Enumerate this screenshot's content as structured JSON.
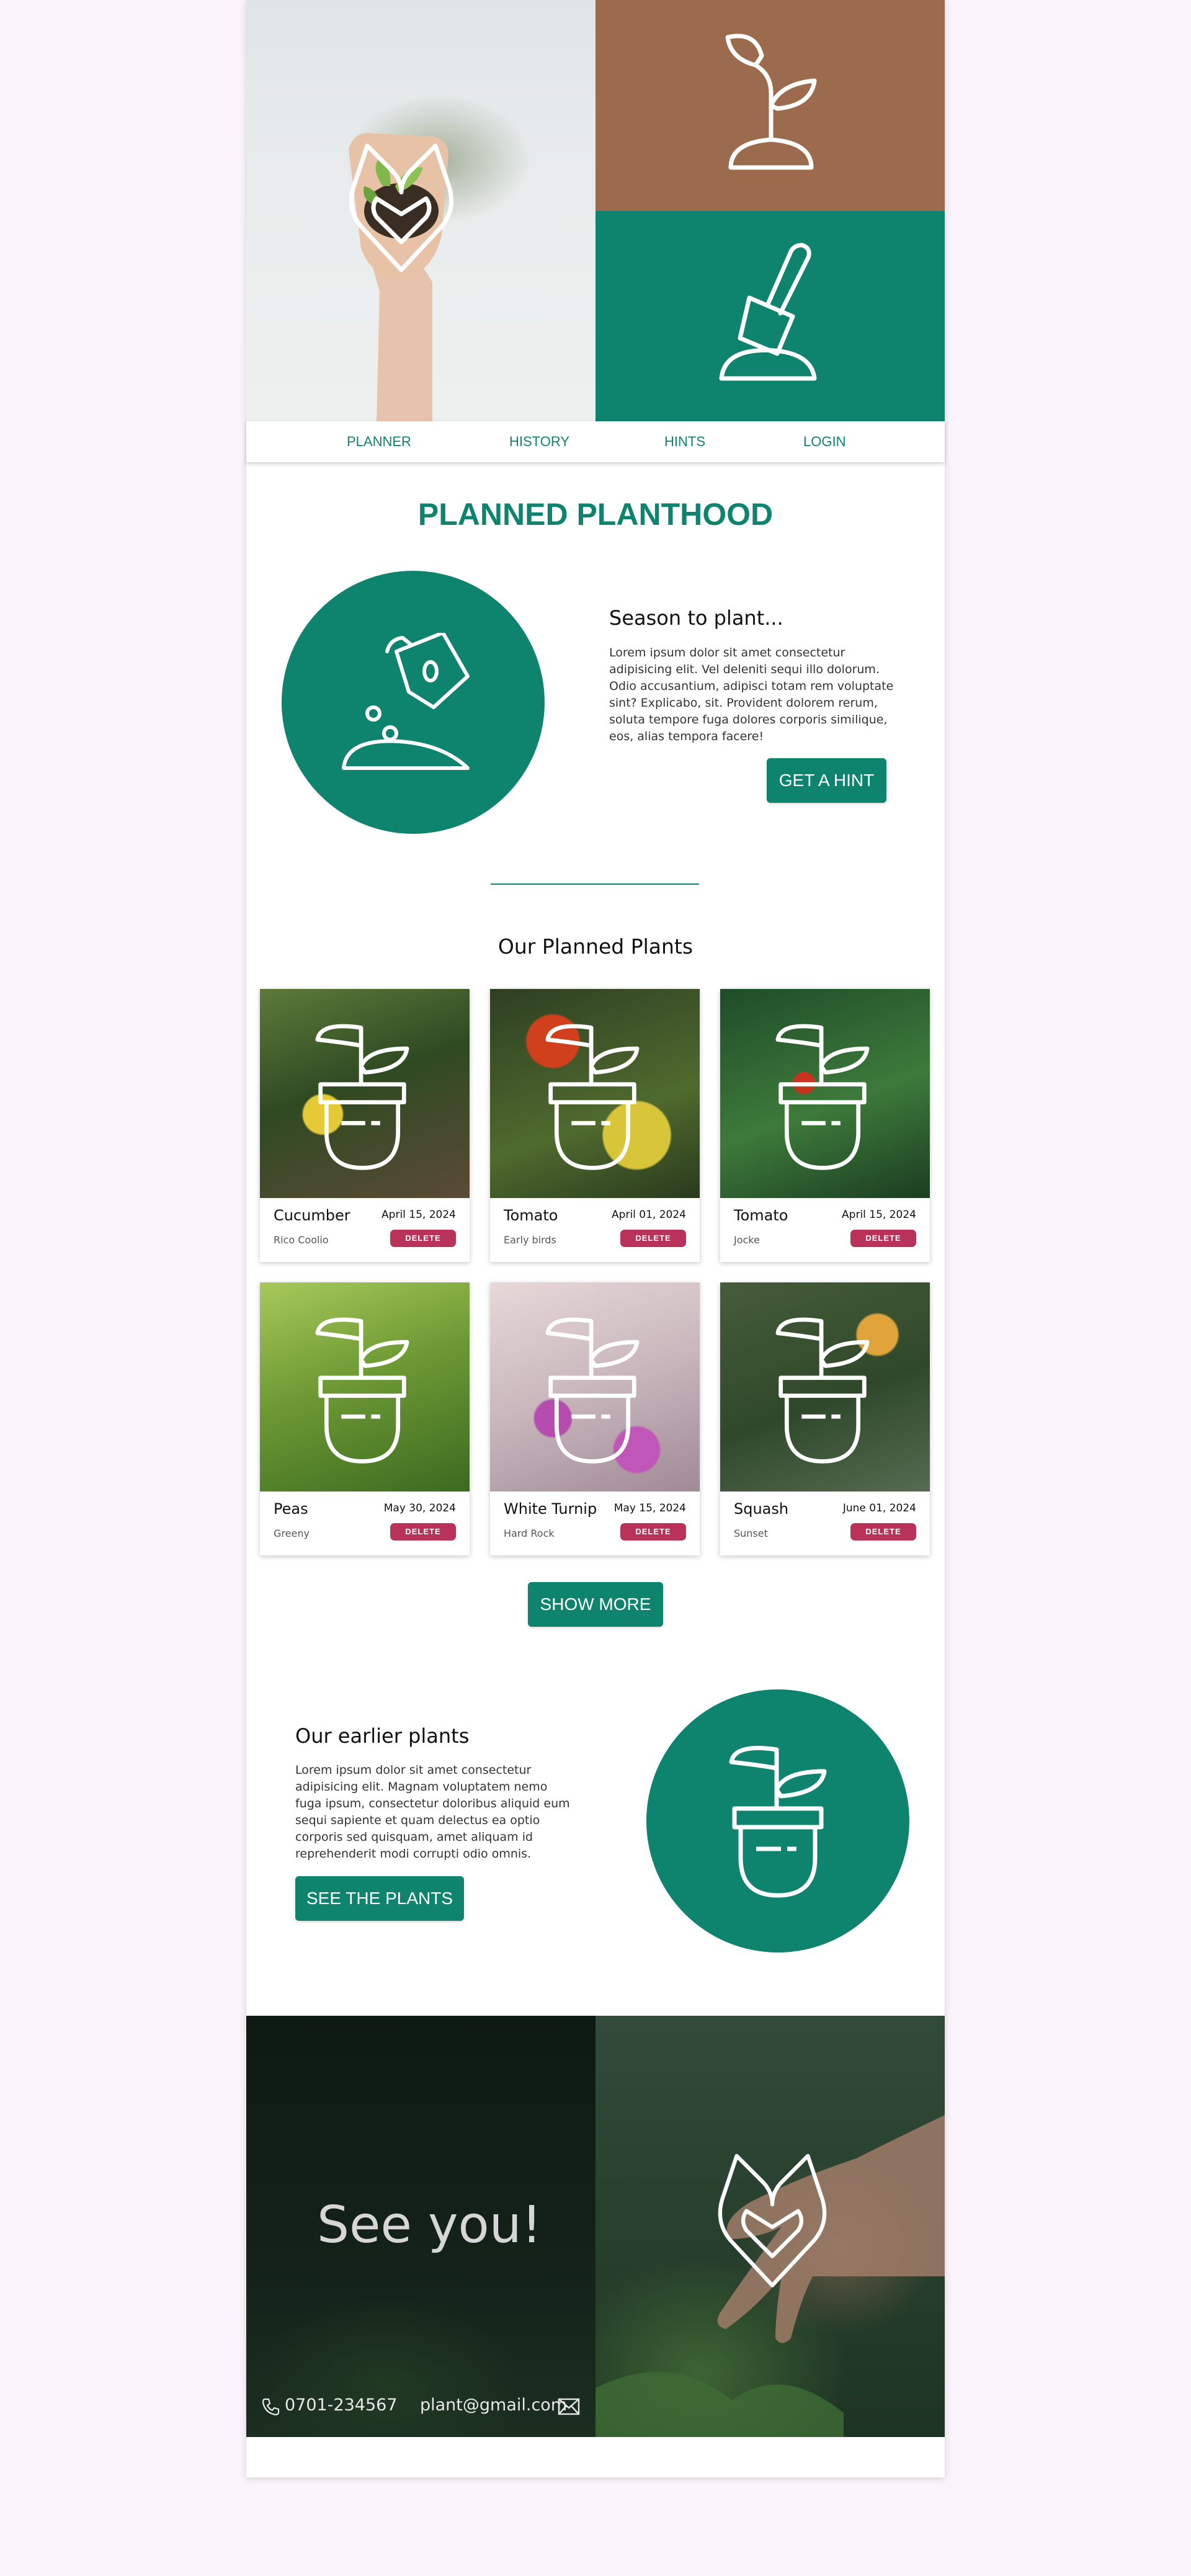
{
  "nav": {
    "items": [
      {
        "label": "PLANNER"
      },
      {
        "label": "HISTORY"
      },
      {
        "label": "HINTS"
      },
      {
        "label": "LOGIN"
      }
    ]
  },
  "page_title": "PLANNED PLANTHOOD",
  "season": {
    "heading": "Season to plant...",
    "text": "Lorem ipsum dolor sit amet consectetur adipisicing elit. Vel deleniti sequi illo dolorum. Odio accusantium, adipisci totam rem voluptate sint? Explicabo, sit. Provident dolorem rerum, soluta tempore fuga dolores corporis similique, eos, alias tempora facere!",
    "button": "GET A HINT"
  },
  "planned": {
    "heading": "Our Planned Plants",
    "delete_label": "DELETE",
    "cards": [
      {
        "name": "Cucumber",
        "date": "April 15, 2024",
        "owner": "Rico Coolio"
      },
      {
        "name": "Tomato",
        "date": "April 01, 2024",
        "owner": "Early birds"
      },
      {
        "name": "Tomato",
        "date": "April 15, 2024",
        "owner": "Jocke"
      },
      {
        "name": "Peas",
        "date": "May 30, 2024",
        "owner": "Greeny"
      },
      {
        "name": "White Turnip",
        "date": "May 15, 2024",
        "owner": "Hard Rock"
      },
      {
        "name": "Squash",
        "date": "June 01, 2024",
        "owner": "Sunset"
      }
    ],
    "show_more": "SHOW MORE"
  },
  "earlier": {
    "heading": "Our earlier plants",
    "text": "Lorem ipsum dolor sit amet consectetur adipisicing elit. Magnam voluptatem nemo fuga ipsum, consectetur doloribus aliquid eum sequi sapiente et quam delectus ea optio corporis sed quisquam, amet aliquam id reprehenderit modi corrupti odio omnis.",
    "button": "SEE THE PLANTS"
  },
  "footer": {
    "greeting": "See you!",
    "phone": "0701-234567",
    "email": "plant@gmail.com"
  },
  "colors": {
    "brand_green": "#0e836e",
    "brown": "#9c6b4e",
    "delete_red": "#b8325a",
    "page_bg": "#fbf3fb"
  },
  "icons": [
    "seedling-icon",
    "shovel-icon",
    "watering-can-icon",
    "plant-pot-icon",
    "heart-leaf-logo-icon",
    "phone-icon",
    "mail-icon"
  ]
}
